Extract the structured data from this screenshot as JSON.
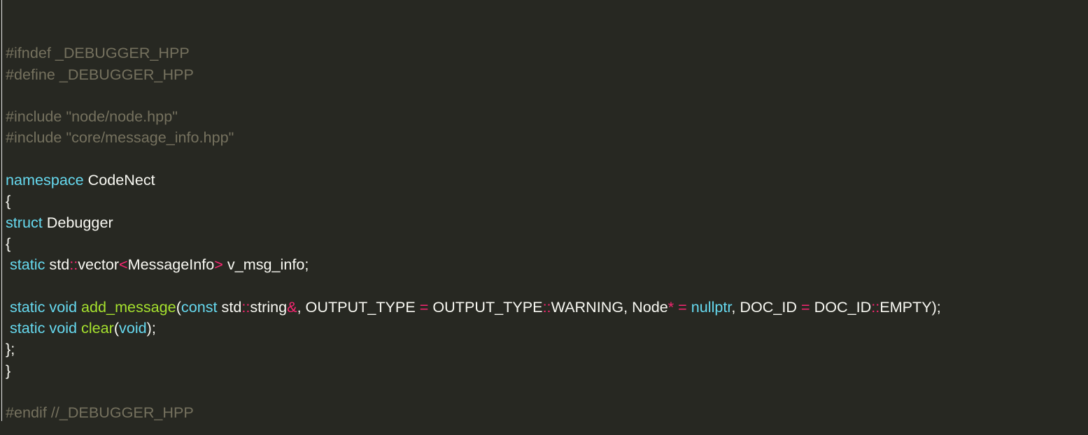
{
  "editor": {
    "language": "cpp",
    "theme": {
      "background": "#272822",
      "plain": "#f8f8f2",
      "comment": "#75715e",
      "keyword": "#66d9ef",
      "operator": "#f92672",
      "function": "#a6e22e"
    },
    "lines": [
      [],
      [
        [
          "#ifndef _DEBUGGER_HPP",
          "comment"
        ]
      ],
      [
        [
          "#define _DEBUGGER_HPP",
          "comment"
        ]
      ],
      [],
      [
        [
          "#include \"node/node.hpp\"",
          "comment"
        ]
      ],
      [
        [
          "#include \"core/message_info.hpp\"",
          "comment"
        ]
      ],
      [],
      [
        [
          "namespace",
          "keyword"
        ],
        [
          " CodeNect",
          "plain"
        ]
      ],
      [
        [
          "{",
          "plain"
        ]
      ],
      [
        [
          "struct",
          "keyword"
        ],
        [
          " Debugger",
          "plain"
        ]
      ],
      [
        [
          "{",
          "plain"
        ]
      ],
      [
        [
          " ",
          "plain"
        ],
        [
          "static",
          "keyword"
        ],
        [
          " std",
          "plain"
        ],
        [
          "::",
          "op"
        ],
        [
          "vector",
          "plain"
        ],
        [
          "<",
          "op"
        ],
        [
          "MessageInfo",
          "plain"
        ],
        [
          ">",
          "op"
        ],
        [
          " v_msg_info;",
          "plain"
        ]
      ],
      [],
      [
        [
          " ",
          "plain"
        ],
        [
          "static",
          "keyword"
        ],
        [
          " ",
          "plain"
        ],
        [
          "void",
          "keyword"
        ],
        [
          " ",
          "plain"
        ],
        [
          "add_message",
          "func"
        ],
        [
          "(",
          "plain"
        ],
        [
          "const",
          "keyword"
        ],
        [
          " std",
          "plain"
        ],
        [
          "::",
          "op"
        ],
        [
          "string",
          "plain"
        ],
        [
          "&",
          "op"
        ],
        [
          ", OUTPUT_TYPE ",
          "plain"
        ],
        [
          "=",
          "op"
        ],
        [
          " OUTPUT_TYPE",
          "plain"
        ],
        [
          "::",
          "op"
        ],
        [
          "WARNING, Node",
          "plain"
        ],
        [
          "*",
          "op"
        ],
        [
          " ",
          "plain"
        ],
        [
          "=",
          "op"
        ],
        [
          " ",
          "plain"
        ],
        [
          "nullptr",
          "keyword"
        ],
        [
          ", DOC_ID ",
          "plain"
        ],
        [
          "=",
          "op"
        ],
        [
          " DOC_ID",
          "plain"
        ],
        [
          "::",
          "op"
        ],
        [
          "EMPTY);",
          "plain"
        ]
      ],
      [
        [
          " ",
          "plain"
        ],
        [
          "static",
          "keyword"
        ],
        [
          " ",
          "plain"
        ],
        [
          "void",
          "keyword"
        ],
        [
          " ",
          "plain"
        ],
        [
          "clear",
          "func"
        ],
        [
          "(",
          "plain"
        ],
        [
          "void",
          "keyword"
        ],
        [
          ");",
          "plain"
        ]
      ],
      [
        [
          "};",
          "plain"
        ]
      ],
      [
        [
          "}",
          "plain"
        ]
      ],
      [],
      [
        [
          "#endif //_DEBUGGER_HPP",
          "comment"
        ]
      ]
    ]
  }
}
